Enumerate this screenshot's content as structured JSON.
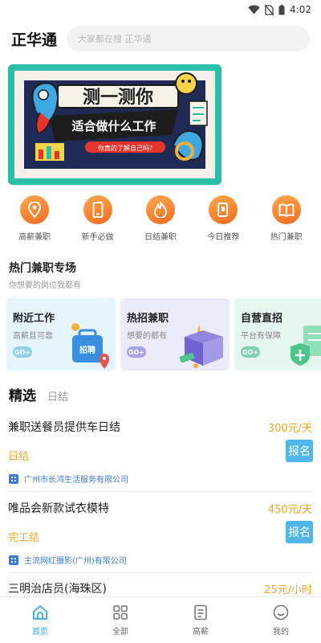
{
  "status_bar": {
    "time": "4:02"
  },
  "header": {
    "title": "正华通",
    "search_placeholder": "大家都在搜 正华通"
  },
  "banner": {
    "headline": "测一测你",
    "subline": "适合做什么工作",
    "tagline": "你真的了解自己吗?"
  },
  "quick_nav": [
    {
      "label": "高薪兼职",
      "icon": "map-pin-icon"
    },
    {
      "label": "新手必做",
      "icon": "phone-icon"
    },
    {
      "label": "日结兼职",
      "icon": "flame-icon"
    },
    {
      "label": "今日推荐",
      "icon": "cards-icon"
    },
    {
      "label": "热门兼职",
      "icon": "book-icon"
    }
  ],
  "hot_section": {
    "title": "热门兼职专场",
    "subtitle": "你想要的岗位我都有",
    "cards": [
      {
        "title": "附近工作",
        "desc": "高薪且可靠",
        "badge": "GO+",
        "art_text": "招聘"
      },
      {
        "title": "热招兼职",
        "desc": "想要的都有",
        "badge": "GO+"
      },
      {
        "title": "自营直招",
        "desc": "平台有保障",
        "badge": "GO+"
      }
    ]
  },
  "tabs": {
    "active": "精选",
    "other": "日结"
  },
  "jobs": [
    {
      "title": "兼职送餐员提供车日结",
      "salary": "300元/天",
      "type": "日结",
      "apply": "报名",
      "company": "广州市长鸿生活服务有限公司"
    },
    {
      "title": "唯品会新款试衣模特",
      "salary": "450元/天",
      "type": "完工结",
      "apply": "报名",
      "company": "主流网红摄影(广州)有限公司"
    },
    {
      "title": "三明治店员(海珠区)",
      "salary": "25元/小时"
    }
  ],
  "bottom_nav": [
    {
      "label": "首页",
      "icon": "home-icon",
      "active": true
    },
    {
      "label": "全部",
      "icon": "grid-icon",
      "active": false
    },
    {
      "label": "高薪",
      "icon": "list-icon",
      "active": false
    },
    {
      "label": "我的",
      "icon": "smile-icon",
      "active": false
    }
  ],
  "colors": {
    "accent_orange": "#f26b21",
    "salary": "#f5a623",
    "apply_button": "#4fb6ea",
    "nav_active": "#2fa8e6"
  }
}
